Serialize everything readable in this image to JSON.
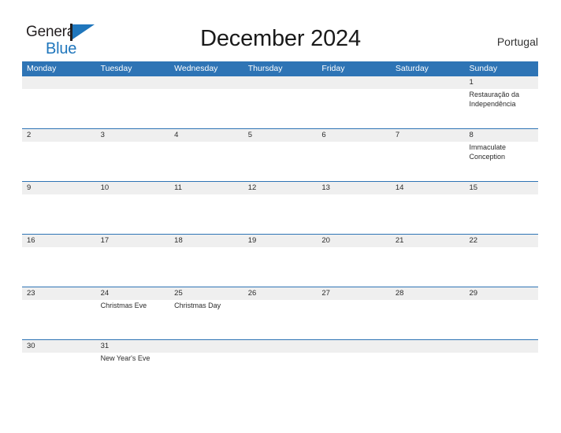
{
  "brand": {
    "name_part1": "General",
    "name_part2": "Blue"
  },
  "header": {
    "title": "December 2024",
    "region": "Portugal"
  },
  "colors": {
    "header_blue": "#2e74b5",
    "brand_blue": "#1f76bc",
    "daynum_band": "#efefef",
    "text_dark": "#2b2b2b"
  },
  "calendar": {
    "weekdays": [
      "Monday",
      "Tuesday",
      "Wednesday",
      "Thursday",
      "Friday",
      "Saturday",
      "Sunday"
    ],
    "weeks": [
      [
        {
          "day": "",
          "event": ""
        },
        {
          "day": "",
          "event": ""
        },
        {
          "day": "",
          "event": ""
        },
        {
          "day": "",
          "event": ""
        },
        {
          "day": "",
          "event": ""
        },
        {
          "day": "",
          "event": ""
        },
        {
          "day": "1",
          "event": "Restauração da Independência"
        }
      ],
      [
        {
          "day": "2",
          "event": ""
        },
        {
          "day": "3",
          "event": ""
        },
        {
          "day": "4",
          "event": ""
        },
        {
          "day": "5",
          "event": ""
        },
        {
          "day": "6",
          "event": ""
        },
        {
          "day": "7",
          "event": ""
        },
        {
          "day": "8",
          "event": "Immaculate Conception"
        }
      ],
      [
        {
          "day": "9",
          "event": ""
        },
        {
          "day": "10",
          "event": ""
        },
        {
          "day": "11",
          "event": ""
        },
        {
          "day": "12",
          "event": ""
        },
        {
          "day": "13",
          "event": ""
        },
        {
          "day": "14",
          "event": ""
        },
        {
          "day": "15",
          "event": ""
        }
      ],
      [
        {
          "day": "16",
          "event": ""
        },
        {
          "day": "17",
          "event": ""
        },
        {
          "day": "18",
          "event": ""
        },
        {
          "day": "19",
          "event": ""
        },
        {
          "day": "20",
          "event": ""
        },
        {
          "day": "21",
          "event": ""
        },
        {
          "day": "22",
          "event": ""
        }
      ],
      [
        {
          "day": "23",
          "event": ""
        },
        {
          "day": "24",
          "event": "Christmas Eve"
        },
        {
          "day": "25",
          "event": "Christmas Day"
        },
        {
          "day": "26",
          "event": ""
        },
        {
          "day": "27",
          "event": ""
        },
        {
          "day": "28",
          "event": ""
        },
        {
          "day": "29",
          "event": ""
        }
      ],
      [
        {
          "day": "30",
          "event": ""
        },
        {
          "day": "31",
          "event": "New Year's Eve"
        },
        {
          "day": "",
          "event": ""
        },
        {
          "day": "",
          "event": ""
        },
        {
          "day": "",
          "event": ""
        },
        {
          "day": "",
          "event": ""
        },
        {
          "day": "",
          "event": ""
        }
      ]
    ]
  }
}
